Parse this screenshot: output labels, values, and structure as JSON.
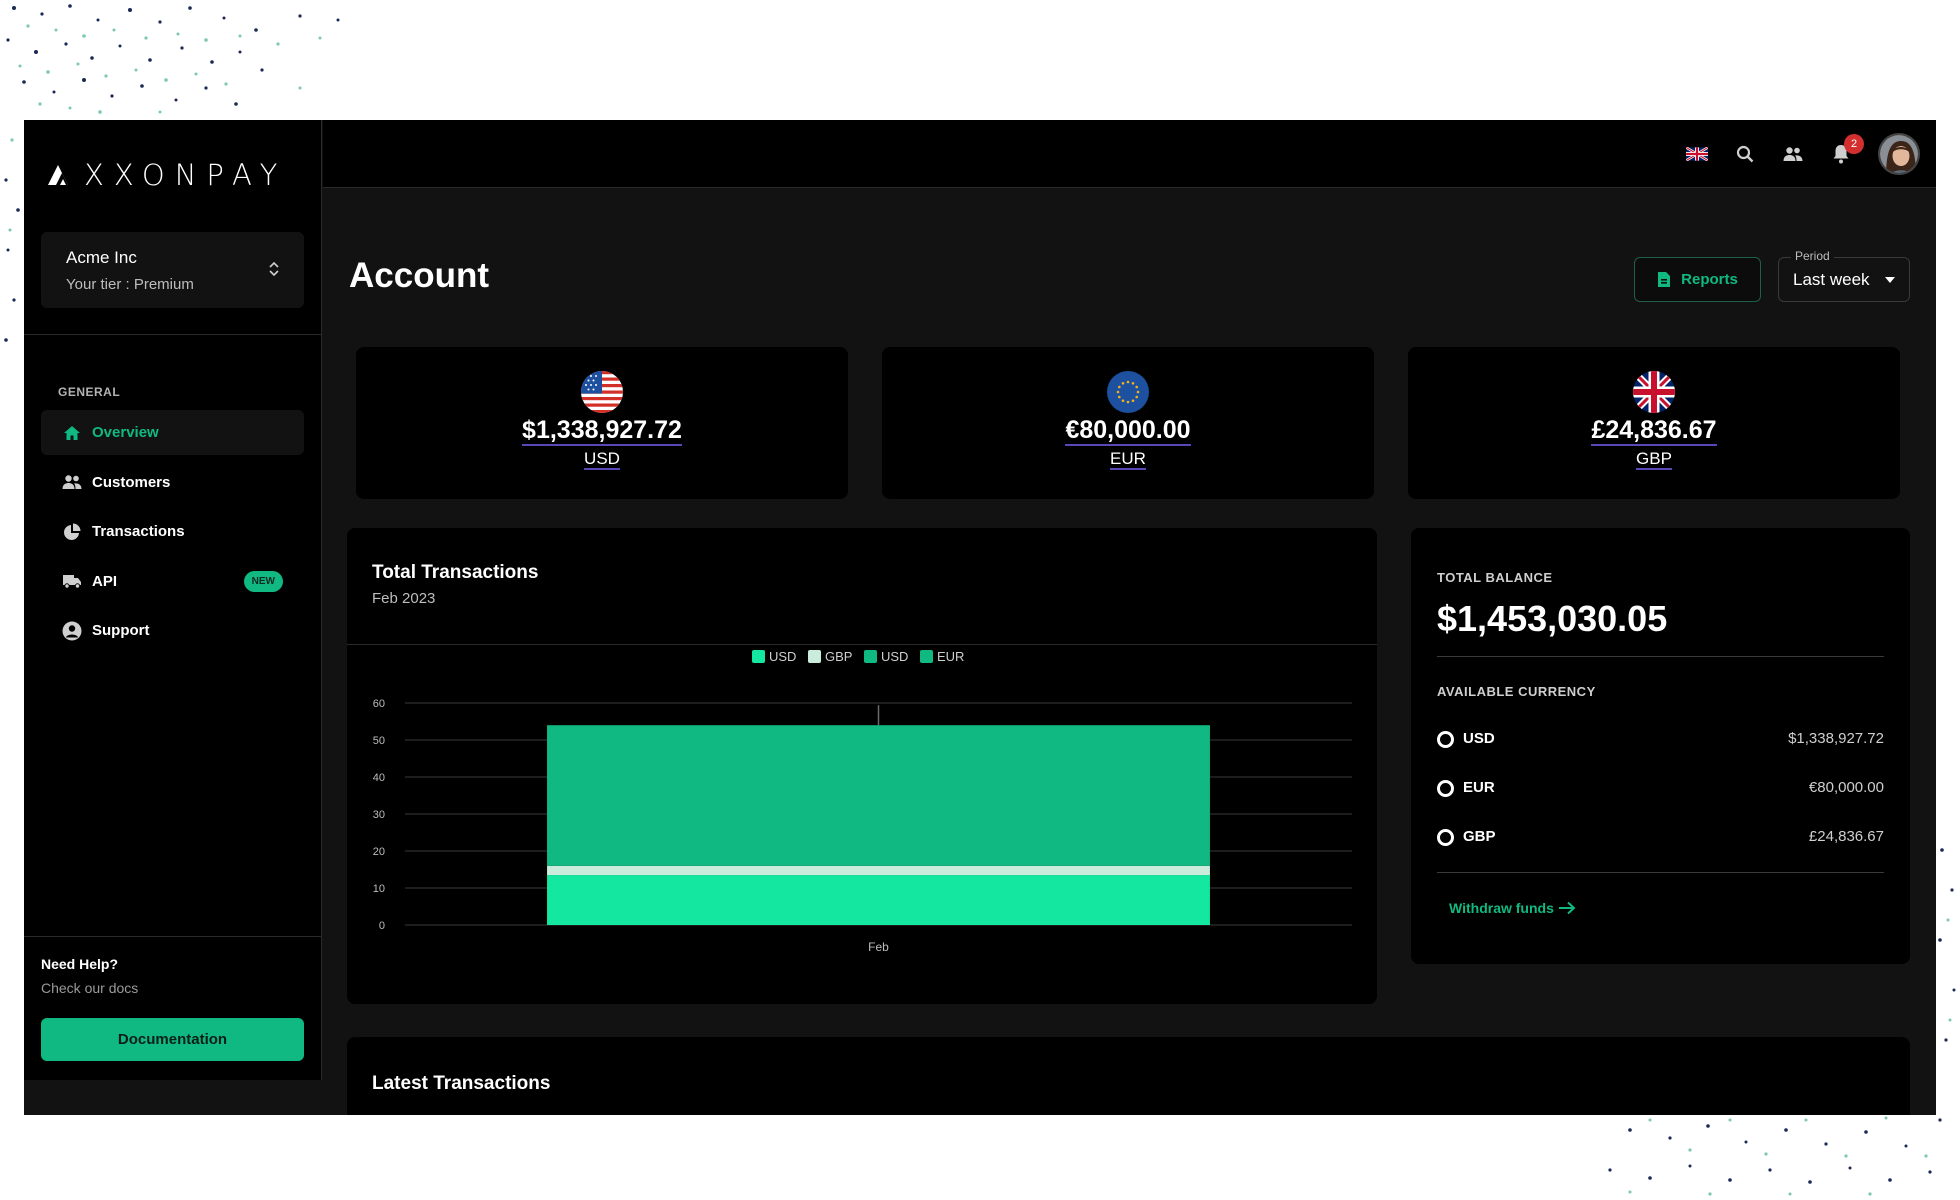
{
  "colors": {
    "accent": "#10b981",
    "accent_light": "#14e8a0",
    "gbp_series": "#c9ecdc",
    "background": "#121212",
    "panel": "#000000",
    "badge_red": "#d32f2f"
  },
  "brand": {
    "logo_text": "XXONPAY",
    "logo_icon": "axxonpay-mark-icon"
  },
  "org": {
    "name": "Acme Inc",
    "tier": "Your tier : Premium",
    "icon": "unfold-chevron-icon"
  },
  "sidebar": {
    "section_label": "GENERAL",
    "items": [
      {
        "label": "Overview",
        "icon": "home-icon",
        "active": true
      },
      {
        "label": "Customers",
        "icon": "users-icon"
      },
      {
        "label": "Transactions",
        "icon": "pie-chart-icon"
      },
      {
        "label": "API",
        "icon": "truck-icon",
        "badge": "NEW"
      },
      {
        "label": "Support",
        "icon": "user-circle-icon"
      }
    ],
    "help_title": "Need Help?",
    "help_subtitle": "Check our docs",
    "documentation_label": "Documentation"
  },
  "topbar": {
    "icons": [
      "uk-flag-icon",
      "search-icon",
      "contacts-icon",
      "bell-icon",
      "avatar"
    ],
    "notification_count": "2"
  },
  "page": {
    "title": "Account",
    "reports_label": "Reports",
    "period_label": "Period",
    "period_value": "Last week"
  },
  "currency_cards": [
    {
      "amount": "$1,338,927.72",
      "code": "USD",
      "flag": "us-flag-icon"
    },
    {
      "amount": "€80,000.00",
      "code": "EUR",
      "flag": "eu-flag-icon"
    },
    {
      "amount": "£24,836.67",
      "code": "GBP",
      "flag": "uk-flag-icon"
    }
  ],
  "chart_data": {
    "type": "bar",
    "stacked": true,
    "title": "Total Transactions",
    "subtitle": "Feb 2023",
    "categories": [
      "Feb"
    ],
    "ylim": [
      0,
      60
    ],
    "yticks": [
      0,
      10,
      20,
      30,
      40,
      50,
      60
    ],
    "legend_position": "top-center",
    "grid": true,
    "series": [
      {
        "name": "USD",
        "values": [
          13.5
        ],
        "color": "#14e8a0"
      },
      {
        "name": "GBP",
        "values": [
          2.5
        ],
        "color": "#c9ecdc"
      },
      {
        "name": "USD",
        "values": [
          38
        ],
        "color": "#10b981"
      },
      {
        "name": "EUR",
        "values": [
          0
        ],
        "color": "#10b981"
      }
    ]
  },
  "balance": {
    "label": "TOTAL BALANCE",
    "amount": "$1,453,030.05",
    "available_label": "AVAILABLE CURRENCY",
    "currencies": [
      {
        "code": "USD",
        "value": "$1,338,927.72"
      },
      {
        "code": "EUR",
        "value": "€80,000.00"
      },
      {
        "code": "GBP",
        "value": "£24,836.67"
      }
    ],
    "withdraw_label": "Withdraw funds"
  },
  "latest": {
    "title": "Latest Transactions"
  }
}
